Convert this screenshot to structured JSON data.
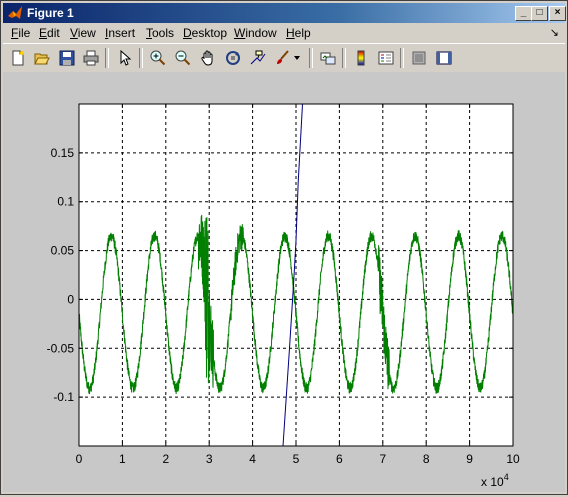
{
  "window": {
    "title": "Figure 1",
    "min": "_",
    "max": "□",
    "close": "×"
  },
  "menu": {
    "items": [
      {
        "label": "File",
        "ul": "F",
        "rest": "ile"
      },
      {
        "label": "Edit",
        "ul": "E",
        "rest": "dit"
      },
      {
        "label": "View",
        "ul": "V",
        "rest": "iew"
      },
      {
        "label": "Insert",
        "ul": "I",
        "rest": "nsert"
      },
      {
        "label": "Tools",
        "ul": "T",
        "rest": "ools"
      },
      {
        "label": "Desktop",
        "ul": "D",
        "rest": "esktop"
      },
      {
        "label": "Window",
        "ul": "W",
        "rest": "indow"
      },
      {
        "label": "Help",
        "ul": "H",
        "rest": "elp"
      }
    ],
    "dock_glyph": "↘"
  },
  "toolbar": {
    "icons": [
      "new-figure-icon",
      "open-file-icon",
      "save-icon",
      "print-icon",
      "pointer-icon",
      "zoom-in-icon",
      "zoom-out-icon",
      "pan-hand-icon",
      "rotate-3d-icon",
      "data-cursor-icon",
      "brush-icon",
      "brush-dropdown-icon",
      "link-plot-icon",
      "colorbar-icon",
      "legend-icon",
      "hide-plot-tools-icon",
      "show-plot-tools-icon"
    ]
  },
  "colors": {
    "series_green": "#007f00",
    "series_blue": "#00007f",
    "grid": "#000000"
  },
  "chart_data": {
    "type": "line",
    "xlim": [
      0,
      100000
    ],
    "ylim": [
      -0.15,
      0.2
    ],
    "x_ticks": [
      "0",
      "1",
      "2",
      "3",
      "4",
      "5",
      "6",
      "7",
      "8",
      "9",
      "10"
    ],
    "y_ticks": [
      "-0.1",
      "-0.05",
      "0",
      "0.05",
      "0.1",
      "0.15"
    ],
    "x_multiplier": "x 10",
    "x_multiplier_exp": "4",
    "grid": true,
    "series": [
      {
        "color": "#007f00",
        "description": "noisy sinusoid, period ~10000, amplitude ~0.08, centered ~-0.01",
        "amplitude": 0.078,
        "offset": -0.013,
        "period": 10000
      },
      {
        "color": "#00007f",
        "x": [
          47000,
          48500,
          49500,
          50000,
          50500,
          51500
        ],
        "y": [
          -0.15,
          -0.05,
          0.02,
          0.06,
          0.12,
          0.2
        ]
      }
    ]
  }
}
